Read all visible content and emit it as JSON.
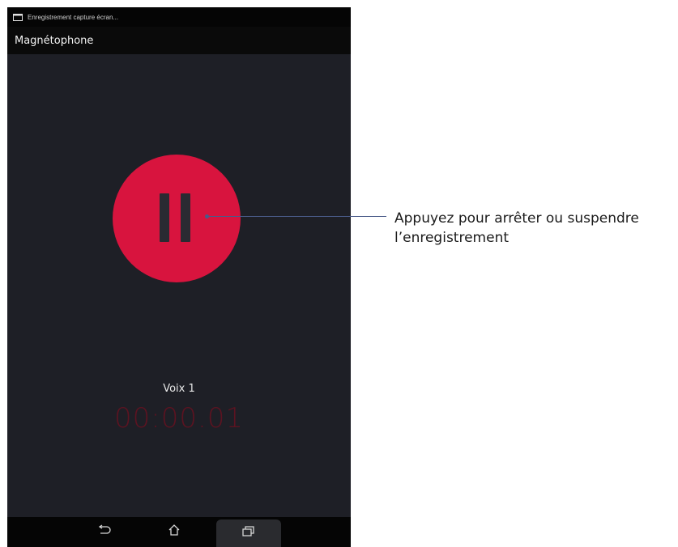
{
  "status_bar": {
    "notification_text": "Enregistrement capture écran..."
  },
  "app_bar": {
    "title": "Magnétophone"
  },
  "recorder": {
    "pause_icon": "pause-icon",
    "accent_color": "#d8143e",
    "voice_label": "Voix 1",
    "timer": "00:00.01"
  },
  "nav_bar": {
    "back_icon": "back-icon",
    "home_icon": "home-icon",
    "recent_icon": "recent-apps-icon"
  },
  "callout": {
    "line1": "Appuyez pour arrêter ou suspendre",
    "line2": "l’enregistrement"
  }
}
